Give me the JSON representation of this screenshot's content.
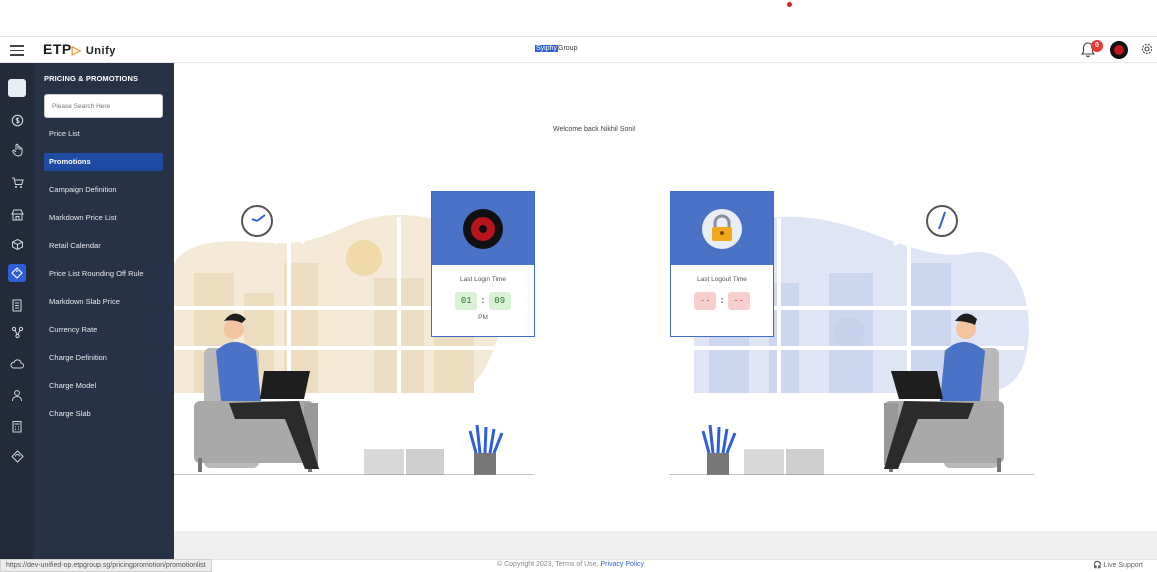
{
  "header": {
    "logo_text": "ETP",
    "logo_suffix": "Unify",
    "company_highlight": "Syiphy",
    "company_rest": "Group",
    "notification_count": "0"
  },
  "sidebar": {
    "section_title": "PRICING & PROMOTIONS",
    "search_placeholder": "Please Search Here",
    "items": [
      {
        "label": "Price List"
      },
      {
        "label": "Promotions"
      },
      {
        "label": "Campaign Definition"
      },
      {
        "label": "Markdown Price List"
      },
      {
        "label": "Retail Calendar"
      },
      {
        "label": "Price List Rounding Off Rule"
      },
      {
        "label": "Markdown Slab Price"
      },
      {
        "label": "Currency Rate"
      },
      {
        "label": "Charge Definition"
      },
      {
        "label": "Charge Model"
      },
      {
        "label": "Charge Slab"
      }
    ],
    "active_index": 1
  },
  "main": {
    "welcome": "Welcome back Nikhil Soni!",
    "login_card": {
      "label": "Last Login Time",
      "hour": "01",
      "minute": "09",
      "ampm": "PM"
    },
    "logout_card": {
      "label": "Last Logout Time",
      "hour": "--",
      "minute": "--"
    }
  },
  "footer": {
    "url": "https://dev-unified-op.etpgroup.sg/pricingpromotion/promotionlist",
    "copyright": "© Copyright 2023, Terms of Use,",
    "privacy": "Privacy Policy",
    "live_support": "Live Support"
  },
  "colors": {
    "sidebar_bg": "#283246",
    "rail_bg": "#232b3a",
    "accent": "#2f5fd7",
    "card_top": "#4a72c6"
  }
}
